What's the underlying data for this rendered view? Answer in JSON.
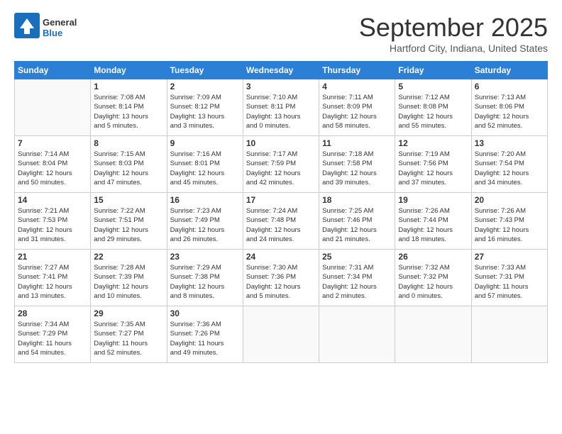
{
  "logo": {
    "general": "General",
    "blue": "Blue"
  },
  "header": {
    "month": "September 2025",
    "location": "Hartford City, Indiana, United States"
  },
  "days_of_week": [
    "Sunday",
    "Monday",
    "Tuesday",
    "Wednesday",
    "Thursday",
    "Friday",
    "Saturday"
  ],
  "weeks": [
    [
      {
        "day": "",
        "info": ""
      },
      {
        "day": "1",
        "info": "Sunrise: 7:08 AM\nSunset: 8:14 PM\nDaylight: 13 hours\nand 5 minutes."
      },
      {
        "day": "2",
        "info": "Sunrise: 7:09 AM\nSunset: 8:12 PM\nDaylight: 13 hours\nand 3 minutes."
      },
      {
        "day": "3",
        "info": "Sunrise: 7:10 AM\nSunset: 8:11 PM\nDaylight: 13 hours\nand 0 minutes."
      },
      {
        "day": "4",
        "info": "Sunrise: 7:11 AM\nSunset: 8:09 PM\nDaylight: 12 hours\nand 58 minutes."
      },
      {
        "day": "5",
        "info": "Sunrise: 7:12 AM\nSunset: 8:08 PM\nDaylight: 12 hours\nand 55 minutes."
      },
      {
        "day": "6",
        "info": "Sunrise: 7:13 AM\nSunset: 8:06 PM\nDaylight: 12 hours\nand 52 minutes."
      }
    ],
    [
      {
        "day": "7",
        "info": "Sunrise: 7:14 AM\nSunset: 8:04 PM\nDaylight: 12 hours\nand 50 minutes."
      },
      {
        "day": "8",
        "info": "Sunrise: 7:15 AM\nSunset: 8:03 PM\nDaylight: 12 hours\nand 47 minutes."
      },
      {
        "day": "9",
        "info": "Sunrise: 7:16 AM\nSunset: 8:01 PM\nDaylight: 12 hours\nand 45 minutes."
      },
      {
        "day": "10",
        "info": "Sunrise: 7:17 AM\nSunset: 7:59 PM\nDaylight: 12 hours\nand 42 minutes."
      },
      {
        "day": "11",
        "info": "Sunrise: 7:18 AM\nSunset: 7:58 PM\nDaylight: 12 hours\nand 39 minutes."
      },
      {
        "day": "12",
        "info": "Sunrise: 7:19 AM\nSunset: 7:56 PM\nDaylight: 12 hours\nand 37 minutes."
      },
      {
        "day": "13",
        "info": "Sunrise: 7:20 AM\nSunset: 7:54 PM\nDaylight: 12 hours\nand 34 minutes."
      }
    ],
    [
      {
        "day": "14",
        "info": "Sunrise: 7:21 AM\nSunset: 7:53 PM\nDaylight: 12 hours\nand 31 minutes."
      },
      {
        "day": "15",
        "info": "Sunrise: 7:22 AM\nSunset: 7:51 PM\nDaylight: 12 hours\nand 29 minutes."
      },
      {
        "day": "16",
        "info": "Sunrise: 7:23 AM\nSunset: 7:49 PM\nDaylight: 12 hours\nand 26 minutes."
      },
      {
        "day": "17",
        "info": "Sunrise: 7:24 AM\nSunset: 7:48 PM\nDaylight: 12 hours\nand 24 minutes."
      },
      {
        "day": "18",
        "info": "Sunrise: 7:25 AM\nSunset: 7:46 PM\nDaylight: 12 hours\nand 21 minutes."
      },
      {
        "day": "19",
        "info": "Sunrise: 7:26 AM\nSunset: 7:44 PM\nDaylight: 12 hours\nand 18 minutes."
      },
      {
        "day": "20",
        "info": "Sunrise: 7:26 AM\nSunset: 7:43 PM\nDaylight: 12 hours\nand 16 minutes."
      }
    ],
    [
      {
        "day": "21",
        "info": "Sunrise: 7:27 AM\nSunset: 7:41 PM\nDaylight: 12 hours\nand 13 minutes."
      },
      {
        "day": "22",
        "info": "Sunrise: 7:28 AM\nSunset: 7:39 PM\nDaylight: 12 hours\nand 10 minutes."
      },
      {
        "day": "23",
        "info": "Sunrise: 7:29 AM\nSunset: 7:38 PM\nDaylight: 12 hours\nand 8 minutes."
      },
      {
        "day": "24",
        "info": "Sunrise: 7:30 AM\nSunset: 7:36 PM\nDaylight: 12 hours\nand 5 minutes."
      },
      {
        "day": "25",
        "info": "Sunrise: 7:31 AM\nSunset: 7:34 PM\nDaylight: 12 hours\nand 2 minutes."
      },
      {
        "day": "26",
        "info": "Sunrise: 7:32 AM\nSunset: 7:32 PM\nDaylight: 12 hours\nand 0 minutes."
      },
      {
        "day": "27",
        "info": "Sunrise: 7:33 AM\nSunset: 7:31 PM\nDaylight: 11 hours\nand 57 minutes."
      }
    ],
    [
      {
        "day": "28",
        "info": "Sunrise: 7:34 AM\nSunset: 7:29 PM\nDaylight: 11 hours\nand 54 minutes."
      },
      {
        "day": "29",
        "info": "Sunrise: 7:35 AM\nSunset: 7:27 PM\nDaylight: 11 hours\nand 52 minutes."
      },
      {
        "day": "30",
        "info": "Sunrise: 7:36 AM\nSunset: 7:26 PM\nDaylight: 11 hours\nand 49 minutes."
      },
      {
        "day": "",
        "info": ""
      },
      {
        "day": "",
        "info": ""
      },
      {
        "day": "",
        "info": ""
      },
      {
        "day": "",
        "info": ""
      }
    ]
  ]
}
